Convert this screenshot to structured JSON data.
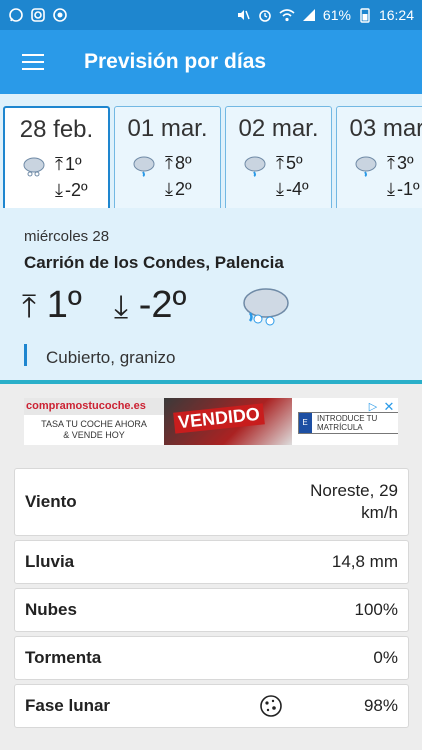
{
  "status_bar": {
    "battery": "61%",
    "time": "16:24",
    "left_icons": [
      "whatsapp-icon",
      "instagram-icon",
      "app-icon"
    ],
    "right_icons": [
      "mute-icon",
      "alarm-icon",
      "wifi-icon",
      "signal-icon",
      "battery-icon"
    ]
  },
  "app_bar": {
    "title": "Previsión por días",
    "menu_icon": "hamburger-menu-icon"
  },
  "days": [
    {
      "date": "28 feb.",
      "max": "1º",
      "min": "-2º",
      "icon": "hail-cloud-icon",
      "selected": true
    },
    {
      "date": "01 mar.",
      "max": "8º",
      "min": "2º",
      "icon": "rain-cloud-icon",
      "selected": false
    },
    {
      "date": "02 mar.",
      "max": "5º",
      "min": "-4º",
      "icon": "rain-cloud-icon",
      "selected": false
    },
    {
      "date": "03 mar.",
      "max": "3º",
      "min": "-1º",
      "icon": "rain-cloud-icon",
      "selected": false
    }
  ],
  "selected_day": {
    "day_label": "miércoles 28",
    "location": "Carrión de los Condes, Palencia",
    "max": "1º",
    "min": "-2º",
    "condition": "Cubierto, granizo",
    "icon": "hail-cloud-icon"
  },
  "ad": {
    "brand": "compramostucoche.es",
    "tagline_1": "TASA TU COCHE AHORA",
    "tagline_2": "& VENDE HOY",
    "stamp": "VENDIDO",
    "input_placeholder": "INTRODUCE TU MATRÍCULA",
    "flag_letter": "E"
  },
  "details": [
    {
      "label": "Viento",
      "value_1": "Noreste, 29",
      "value_2": "km/h"
    },
    {
      "label": "Lluvia",
      "value_1": "14,8 mm"
    },
    {
      "label": "Nubes",
      "value_1": "100%"
    },
    {
      "label": "Tormenta",
      "value_1": "0%"
    },
    {
      "label": "Fase lunar",
      "value_1": "98%",
      "icon": "moon-phase-icon"
    }
  ],
  "colors": {
    "status_bar": "#1e86cf",
    "app_bar": "#2a9ae8",
    "panel": "#dff1fb",
    "accent": "#1e86cf"
  }
}
